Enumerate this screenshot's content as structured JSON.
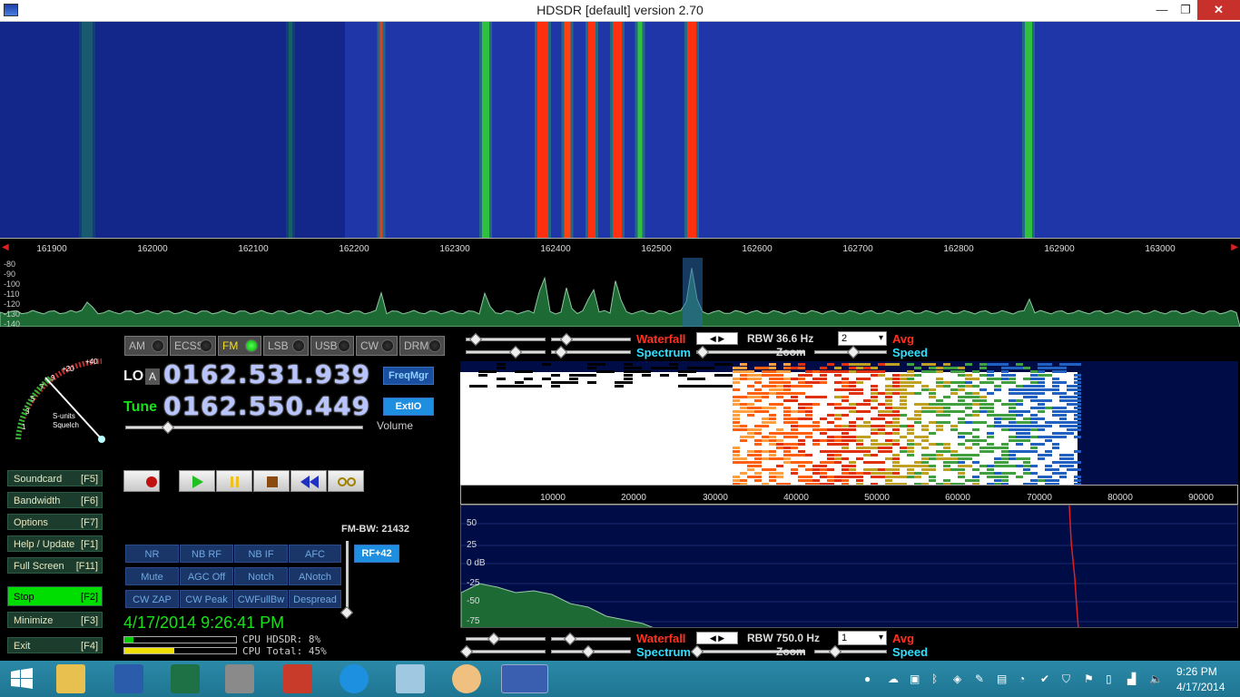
{
  "window": {
    "title": "HDSDR [default]  version 2.70",
    "min": "—",
    "max": "❐",
    "close": "✕"
  },
  "freq_axis": {
    "ticks": [
      "161900",
      "162000",
      "162100",
      "162200",
      "162300",
      "162400",
      "162500",
      "162600",
      "162700",
      "162800",
      "162900",
      "163000"
    ]
  },
  "spectrum": {
    "db_labels": [
      "-80",
      "-90",
      "-100",
      "-110",
      "-120",
      "-130",
      "-140"
    ]
  },
  "smeter": {
    "labels": [
      "1",
      "3",
      "5",
      "7",
      "9",
      "+20",
      "+40"
    ],
    "caption1": "S-units",
    "caption2": "Squelch"
  },
  "modes": [
    {
      "label": "AM",
      "active": false
    },
    {
      "label": "ECSS",
      "active": false
    },
    {
      "label": "FM",
      "active": true
    },
    {
      "label": "LSB",
      "active": false
    },
    {
      "label": "USB",
      "active": false
    },
    {
      "label": "CW",
      "active": false
    },
    {
      "label": "DRM",
      "active": false
    }
  ],
  "lo": {
    "label": "LO",
    "badge": "A",
    "value": "0162.531.939"
  },
  "tune": {
    "label": "Tune",
    "value": "0162.550.449"
  },
  "freqmgr": "FreqMgr",
  "extio": "ExtIO",
  "volume_label": "Volume",
  "side_buttons": [
    {
      "label": "Soundcard",
      "key": "[F5]"
    },
    {
      "label": "Bandwidth",
      "key": "[F6]"
    },
    {
      "label": "Options",
      "key": "[F7]"
    },
    {
      "label": "Help / Update",
      "key": "[F1]"
    },
    {
      "label": "Full Screen",
      "key": "[F11]"
    },
    {
      "label": "Stop",
      "key": "[F2]"
    },
    {
      "label": "Minimize",
      "key": "[F3]"
    },
    {
      "label": "Exit",
      "key": "[F4]"
    }
  ],
  "fm_bw": "FM-BW: 21432",
  "rf_button": "RF+42",
  "dsp_buttons": [
    [
      "NR",
      "NB RF",
      "NB IF",
      "AFC"
    ],
    [
      "Mute",
      "AGC Off",
      "Notch",
      "ANotch"
    ],
    [
      "CW ZAP",
      "CW Peak",
      "CWFullBw",
      "Despread"
    ]
  ],
  "datetime": "4/17/2014 9:26:41 PM",
  "cpu": {
    "hdsdr": "CPU HDSDR: 8%",
    "total": "CPU Total: 45%"
  },
  "rf_controls": {
    "waterfall": "Waterfall",
    "spectrum": "Spectrum",
    "rbw": "RBW 36.6 Hz",
    "avg_value": "2",
    "avg": "Avg",
    "zoom": "Zoom",
    "speed": "Speed"
  },
  "af_controls": {
    "waterfall": "Waterfall",
    "spectrum": "Spectrum",
    "rbw": "RBW 750.0 Hz",
    "avg_value": "1",
    "avg": "Avg",
    "zoom": "Zoom",
    "speed": "Speed"
  },
  "af_axis": {
    "ticks": [
      "10000",
      "20000",
      "30000",
      "40000",
      "50000",
      "60000",
      "70000",
      "80000",
      "90000"
    ]
  },
  "af_db": [
    "50",
    "25",
    "0 dB",
    "-25",
    "-50",
    "-75"
  ],
  "taskbar": {
    "time": "9:26 PM",
    "date": "4/17/2014"
  },
  "colors": {
    "waterfall_bg": "#1f36a8",
    "signal_green": "#30c040",
    "signal_red": "#ff3010",
    "stop_green": "#00dd00",
    "lcd_blue": "#b8c4ff"
  }
}
